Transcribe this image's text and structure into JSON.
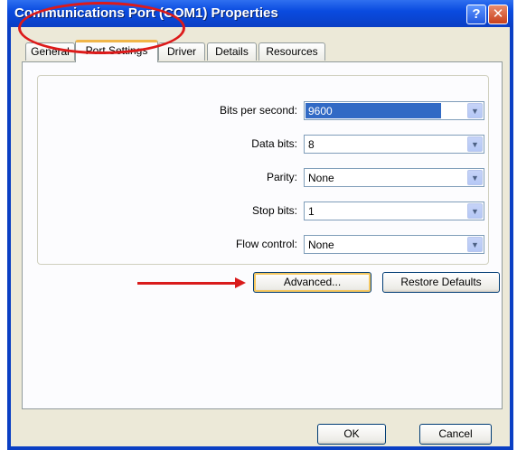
{
  "window": {
    "title": "Communications Port (COM1) Properties",
    "help_glyph": "?",
    "close_glyph": "✕"
  },
  "tabs": [
    {
      "label": "General",
      "active": false
    },
    {
      "label": "Port Settings",
      "active": true
    },
    {
      "label": "Driver",
      "active": false
    },
    {
      "label": "Details",
      "active": false
    },
    {
      "label": "Resources",
      "active": false
    }
  ],
  "port_settings": {
    "fields": [
      {
        "label": "Bits per second:",
        "value": "9600"
      },
      {
        "label": "Data bits:",
        "value": "8"
      },
      {
        "label": "Parity:",
        "value": "None"
      },
      {
        "label": "Stop bits:",
        "value": "1"
      },
      {
        "label": "Flow control:",
        "value": "None"
      }
    ],
    "dropdown_glyph": "▼",
    "advanced_label": "Advanced...",
    "restore_label": "Restore Defaults"
  },
  "footer": {
    "ok_label": "OK",
    "cancel_label": "Cancel"
  },
  "colors": {
    "titlebar": "#0a3fc4",
    "annotation": "#d91b1b",
    "selection": "#316ac5"
  }
}
